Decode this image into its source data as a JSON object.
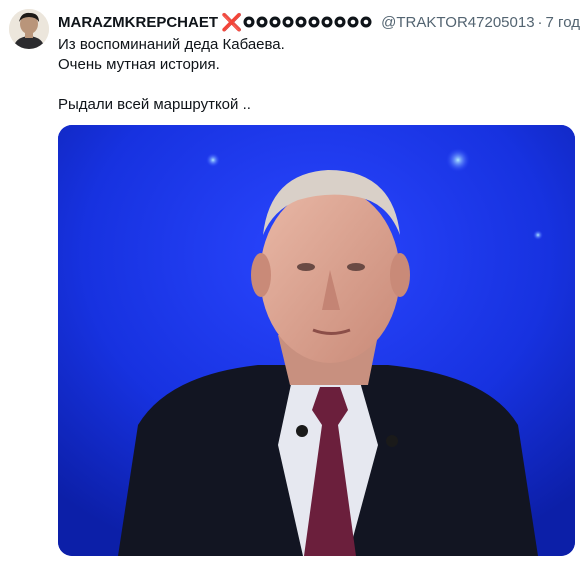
{
  "tweet": {
    "display_name": "MARAZMKREPCHAET",
    "cross_icon": "❌",
    "handle": "@TRAKTOR47205013",
    "separator": "·",
    "timestamp": "7 год",
    "lines": [
      "Из воспоминаний деда Кабаева.",
      "Очень мутная история.",
      "",
      "Рыдали всей маршруткой .."
    ]
  },
  "icons": {
    "avatar": "user-avatar-photo",
    "cross": "red-cross-icon",
    "dots": "black-circle-row-icon",
    "media": "video-thumbnail"
  },
  "colors": {
    "text": "#0f1419",
    "secondary": "#536471",
    "cross": "#e0245e",
    "media_background": "#1a2fd9"
  }
}
